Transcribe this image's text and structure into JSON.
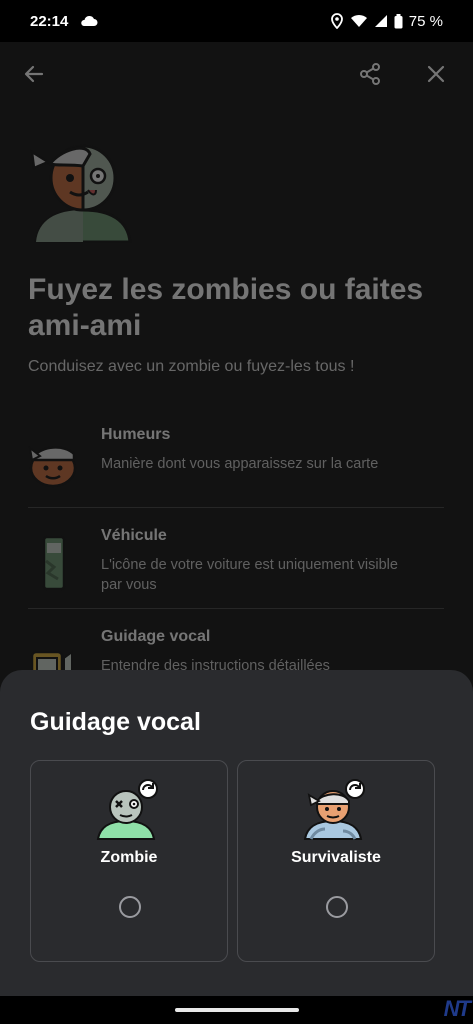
{
  "status_bar": {
    "time": "22:14",
    "battery": "75 %"
  },
  "page": {
    "title": "Fuyez les zombies ou faites ami-ami",
    "subtitle": "Conduisez avec un zombie ou fuyez-les tous !",
    "settings": [
      {
        "title": "Humeurs",
        "description": "Manière dont vous apparaissez sur la carte",
        "icon": "mood-icon"
      },
      {
        "title": "Véhicule",
        "description": "L'icône de votre voiture est uniquement visible par vous",
        "icon": "vehicle-icon"
      },
      {
        "title": "Guidage vocal",
        "description": "Entendre des instructions détaillées",
        "icon": "voice-guidance-icon"
      }
    ]
  },
  "sheet": {
    "title": "Guidage vocal",
    "options": [
      {
        "label": "Zombie",
        "selected": false,
        "icon": "zombie-avatar-icon"
      },
      {
        "label": "Survivaliste",
        "selected": false,
        "icon": "survivalist-avatar-icon"
      }
    ]
  },
  "watermark": "NT",
  "colors": {
    "sheet_bg": "#2a2b2e",
    "page_bg": "#121212",
    "text": "#ffffff"
  }
}
